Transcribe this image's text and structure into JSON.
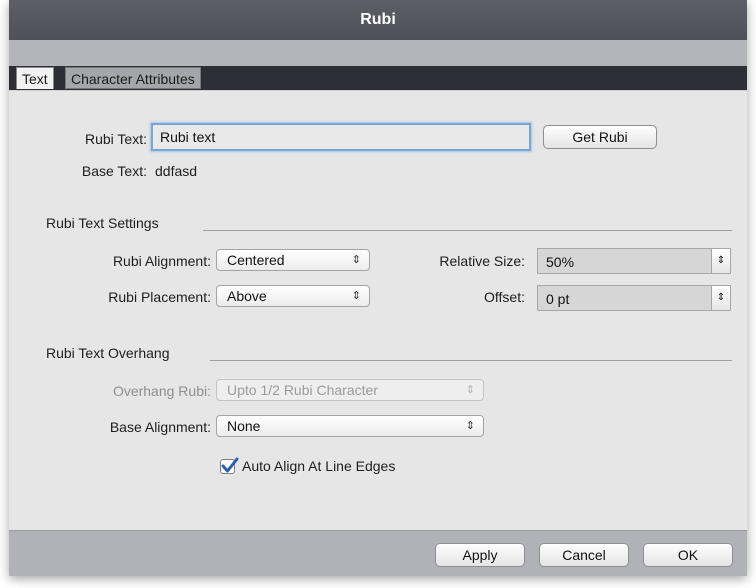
{
  "window": {
    "title": "Rubi"
  },
  "tabs": [
    {
      "label": "Text",
      "active": true
    },
    {
      "label": "Character Attributes",
      "active": false
    }
  ],
  "rubi_text": {
    "label": "Rubi Text:",
    "value": "Rubi text"
  },
  "get_rubi_button": {
    "label": "Get Rubi"
  },
  "base_text": {
    "label": "Base Text:",
    "value": "ddfasd"
  },
  "rubi_text_settings": {
    "heading": "Rubi Text Settings",
    "alignment": {
      "label": "Rubi Alignment:",
      "value": "Centered"
    },
    "placement": {
      "label": "Rubi Placement:",
      "value": "Above"
    },
    "relative_size": {
      "label": "Relative Size:",
      "value": "50%"
    },
    "offset": {
      "label": "Offset:",
      "value": "0 pt"
    }
  },
  "rubi_text_overhang": {
    "heading": "Rubi Text Overhang",
    "overhang_rubi": {
      "label": "Overhang Rubi:",
      "value": "Upto 1/2 Rubi Character",
      "enabled": false
    },
    "base_alignment": {
      "label": "Base Alignment:",
      "value": "None"
    },
    "auto_align": {
      "label": "Auto Align At Line Edges",
      "checked": true
    }
  },
  "buttons": {
    "apply": "Apply",
    "cancel": "Cancel",
    "ok": "OK"
  },
  "icons": {
    "popup_arrows": "updown-arrows-icon",
    "checkmark": "checkmark-icon"
  },
  "colors": {
    "focus_ring": "#7ca5d6",
    "check_accent": "#2b5fb0",
    "titlebar": "#56575e"
  }
}
